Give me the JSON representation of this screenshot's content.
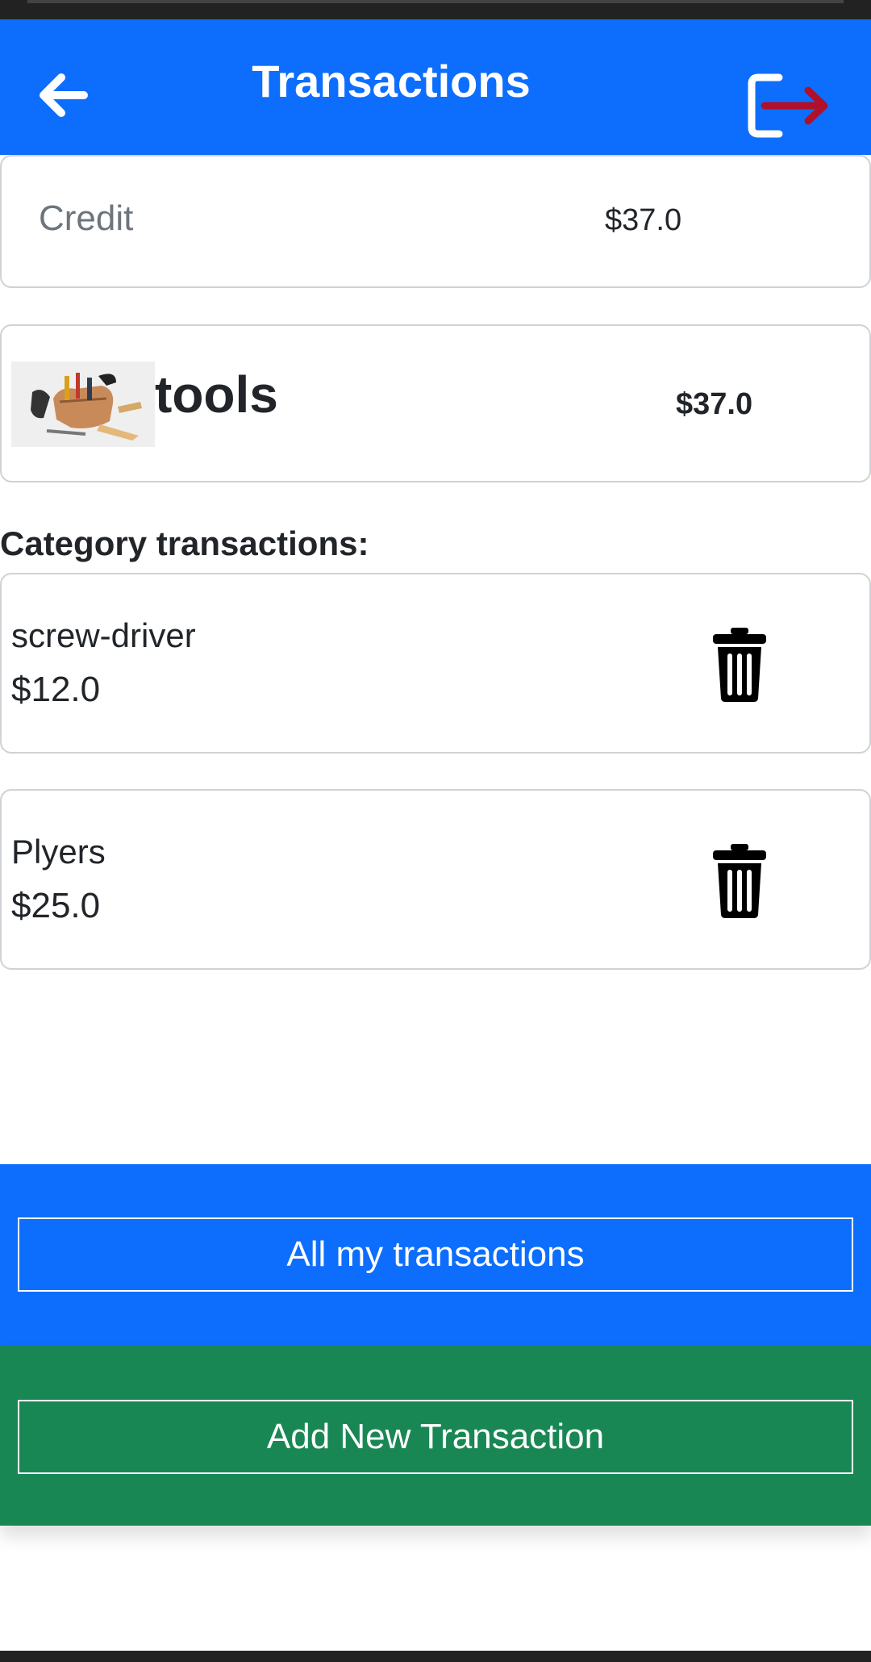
{
  "header": {
    "title": "Transactions",
    "back_icon": "arrow-left-icon",
    "logout_icon": "logout-icon",
    "logout_arrow_color": "#b0102a"
  },
  "credit": {
    "label": "Credit",
    "value": "$37.0"
  },
  "category": {
    "name": "tools",
    "amount": "$37.0",
    "image_icon": "tool-belt-image"
  },
  "section": {
    "heading": "Category transactions:"
  },
  "transactions": [
    {
      "name": "screw-driver",
      "amount": "$12.0",
      "delete_icon": "trash-icon"
    },
    {
      "name": "Plyers",
      "amount": "$25.0",
      "delete_icon": "trash-icon"
    }
  ],
  "footer": {
    "all_transactions_label": "All my transactions",
    "add_transaction_label": "Add New Transaction"
  },
  "colors": {
    "primary": "#0d6efd",
    "success": "#198754"
  }
}
